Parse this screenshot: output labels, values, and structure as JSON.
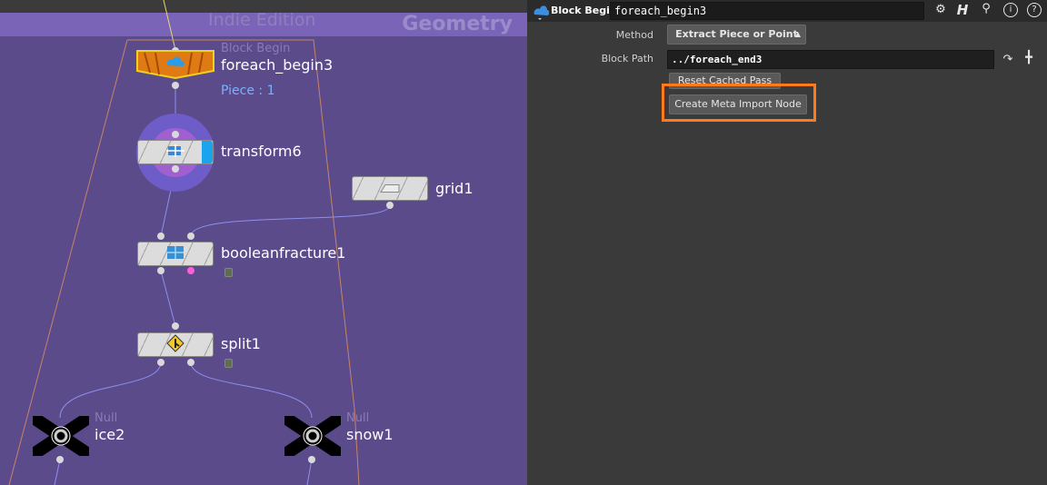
{
  "network": {
    "edition": "Indie Edition",
    "context": "Geometry",
    "nodes": {
      "foreach_begin": {
        "type": "Block Begin",
        "name": "foreach_begin3",
        "piece": "Piece : 1"
      },
      "transform": {
        "name": "transform6"
      },
      "grid": {
        "name": "grid1"
      },
      "boolean": {
        "name": "booleanfracture1"
      },
      "split": {
        "name": "split1"
      },
      "ice": {
        "type": "Null",
        "name": "ice2"
      },
      "snow": {
        "type": "Null",
        "name": "snow1"
      }
    }
  },
  "params": {
    "node_type": "Block Begin",
    "node_name": "foreach_begin3",
    "method_label": "Method",
    "method_value": "Extract Piece or Point",
    "block_path_label": "Block Path",
    "block_path_value": "../foreach_end3",
    "reset_label": "Reset Cached Pass",
    "create_meta_label": "Create Meta Import Node",
    "highlight_color": "#ff7a1a"
  }
}
